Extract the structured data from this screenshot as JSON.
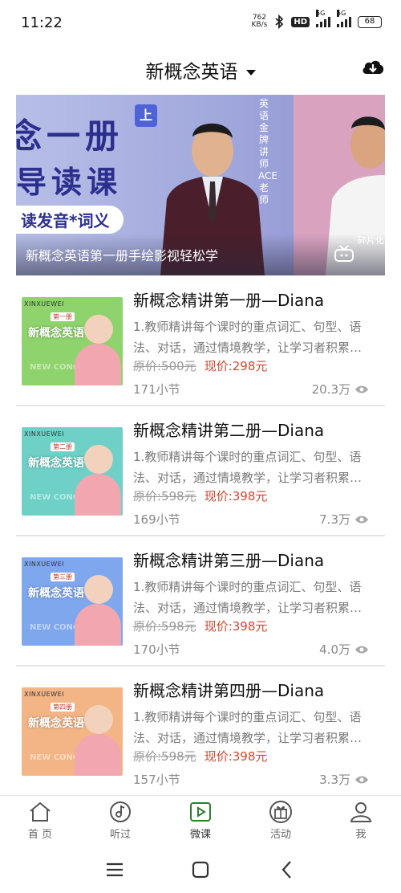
{
  "status_bar": {
    "time": "11:22",
    "net_speed_value": "762",
    "net_speed_unit": "KB/s",
    "hd": "HD",
    "signal_1_label": "5G",
    "signal_2_label": "5G",
    "battery": "68",
    "icons": [
      "bluetooth-icon",
      "signal-icon",
      "battery-icon"
    ]
  },
  "header": {
    "title": "新概念英语",
    "icons": [
      "caret-down-icon",
      "cloud-download-icon"
    ]
  },
  "banner": {
    "title_line1": "念一册",
    "title_line2": "导读课",
    "ribbon": "上",
    "tag": "读发音*词义",
    "vertical_text": "英语金牌讲师ACE老师",
    "caption": "新概念英语第一册手绘影视轻松学",
    "side_caption": "碎片化词",
    "colors": {
      "primary": "#2d2f8e",
      "accent": "#4f63d6"
    }
  },
  "courses": [
    {
      "title": "新概念精讲第一册—Diana",
      "desc": "1.教师精讲每个课时的重点词汇、句型、语法、对话，通过情境教学，让学习者积累…",
      "orig_price": "原价:500元",
      "cur_price": "现价:298元",
      "lessons": "171小节",
      "views": "20.3万",
      "thumb": {
        "brand": "XINXUEWEI",
        "name": "新概念英语",
        "level": "第一册",
        "watermark": "NEW CONCEPT",
        "bg": "#8fd36c"
      }
    },
    {
      "title": "新概念精讲第二册—Diana",
      "desc": "1.教师精讲每个课时的重点词汇、句型、语法、对话，通过情境教学，让学习者积累…",
      "orig_price": "原价:598元",
      "cur_price": "现价:398元",
      "lessons": "169小节",
      "views": "7.3万",
      "thumb": {
        "brand": "XINXUEWEI",
        "name": "新概念英语",
        "level": "第二册",
        "watermark": "NEW CONCEPT",
        "bg": "#6fd0c7"
      }
    },
    {
      "title": "新概念精讲第三册—Diana",
      "desc": "1.教师精讲每个课时的重点词汇、句型、语法、对话，通过情境教学，让学习者积累…",
      "orig_price": "原价:598元",
      "cur_price": "现价:398元",
      "lessons": "170小节",
      "views": "4.0万",
      "thumb": {
        "brand": "XINXUEWEI",
        "name": "新概念英语",
        "level": "第三册",
        "watermark": "NEW CONCEPT",
        "bg": "#7ea7ee"
      }
    },
    {
      "title": "新概念精讲第四册—Diana",
      "desc": "1.教师精讲每个课时的重点词汇、句型、语法、对话，通过情境教学，让学习者积累…",
      "orig_price": "原价:598元",
      "cur_price": "现价:398元",
      "lessons": "157小节",
      "views": "3.3万",
      "thumb": {
        "brand": "XINXUEWEI",
        "name": "新概念英语",
        "level": "第四册",
        "watermark": "NEW CONCEPT",
        "bg": "#f3b585"
      }
    }
  ],
  "tabs": [
    {
      "label": "首 页",
      "icon": "home-icon"
    },
    {
      "label": "听过",
      "icon": "music-disc-icon"
    },
    {
      "label": "微课",
      "icon": "video-play-icon",
      "active": true
    },
    {
      "label": "活动",
      "icon": "gift-icon"
    },
    {
      "label": "我",
      "icon": "person-icon"
    }
  ],
  "colors": {
    "active_tab": "#2e7d32",
    "price": "#d0462f"
  }
}
